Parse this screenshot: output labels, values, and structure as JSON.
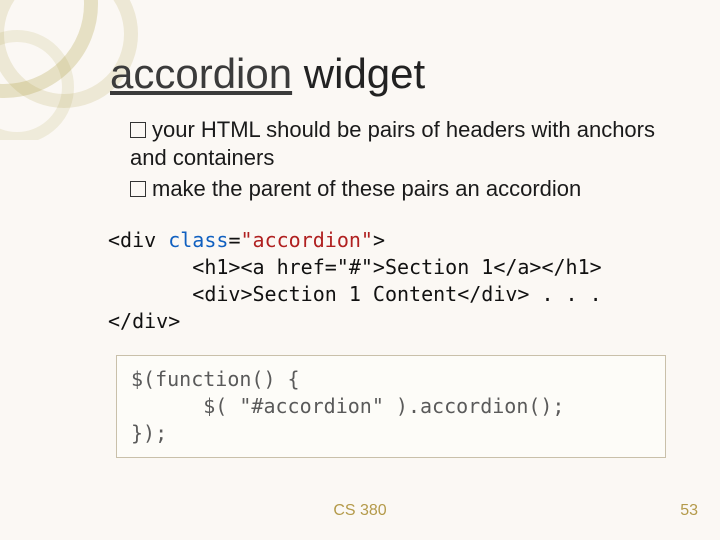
{
  "title": {
    "linked": "accordion",
    "rest": " widget"
  },
  "bullets": [
    "your HTML should be pairs of headers with anchors and containers",
    "make the parent of these pairs an accordion"
  ],
  "code1": {
    "l1a": "<div ",
    "l1b": "class",
    "l1c": "=",
    "l1d": "\"accordion\"",
    "l1e": ">",
    "l2": "       <h1><a href=\"#\">Section 1</a></h1>",
    "l3": "       <div>Section 1 Content</div>",
    "l3e": " . . .",
    "l4": "</div>"
  },
  "code2": {
    "l1": "$(function() {",
    "l2": "      $( \"#accordion\" ).accordion();",
    "l3": "});"
  },
  "footer": {
    "course": "CS 380",
    "slide_num": "53"
  }
}
